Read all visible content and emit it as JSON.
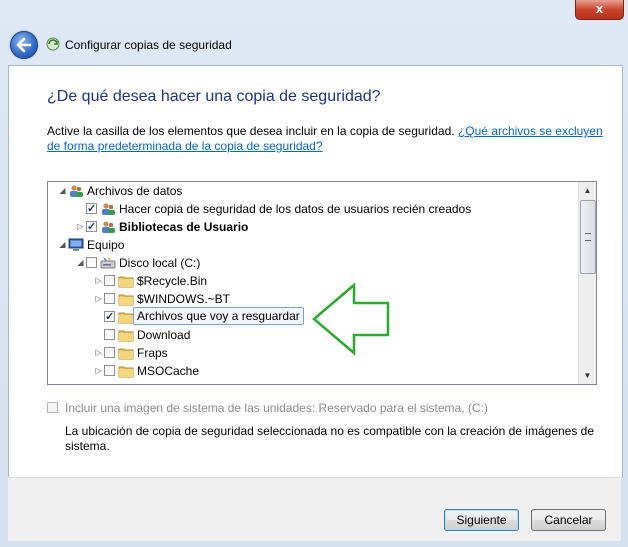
{
  "window": {
    "title": "Configurar copias de seguridad",
    "close_glyph": "x"
  },
  "page": {
    "heading": "¿De qué desea hacer una copia de seguridad?",
    "description": "Active la casilla de los elementos que desea incluir en la copia de seguridad.",
    "link": "¿Qué archivos se excluyen de forma predeterminada de la copia de seguridad?"
  },
  "tree": {
    "items": [
      {
        "label": "Archivos de datos",
        "checkbox": "none",
        "expander": "expanded",
        "icon": "users-icon"
      },
      {
        "label": "Hacer copia de seguridad de los datos de usuarios recién creados",
        "checkbox": "checked",
        "expander": "none",
        "icon": "users-icon"
      },
      {
        "label": "Bibliotecas de Usuario",
        "checkbox": "checked",
        "expander": "collapsed",
        "icon": "library-icon",
        "bold": true
      },
      {
        "label": "Equipo",
        "checkbox": "none",
        "expander": "expanded",
        "icon": "computer-icon"
      },
      {
        "label": "Disco local (C:)",
        "checkbox": "unchecked",
        "expander": "expanded",
        "icon": "drive-icon"
      },
      {
        "label": "$Recycle.Bin",
        "checkbox": "unchecked",
        "expander": "collapsed",
        "icon": "folder-icon"
      },
      {
        "label": "$WINDOWS.~BT",
        "checkbox": "unchecked",
        "expander": "collapsed",
        "icon": "folder-icon"
      },
      {
        "label": "Archivos que voy a resguardar",
        "checkbox": "checked",
        "expander": "none",
        "icon": "folder-icon",
        "selected": true
      },
      {
        "label": "Download",
        "checkbox": "unchecked",
        "expander": "none",
        "icon": "folder-icon"
      },
      {
        "label": "Fraps",
        "checkbox": "unchecked",
        "expander": "collapsed",
        "icon": "folder-icon"
      },
      {
        "label": "MSOCache",
        "checkbox": "unchecked",
        "expander": "collapsed",
        "icon": "folder-icon"
      }
    ]
  },
  "system_image": {
    "label": "Incluir una imagen de sistema de las unidades: Reservado para el sistema, (C:)",
    "note": "La ubicación de copia de seguridad seleccionada no es compatible con la creación de imágenes de sistema."
  },
  "buttons": {
    "next": "Siguiente",
    "cancel": "Cancelar"
  },
  "colors": {
    "heading": "#1e3287",
    "link": "#0066cc",
    "annotation_arrow": "#2ea82e"
  }
}
